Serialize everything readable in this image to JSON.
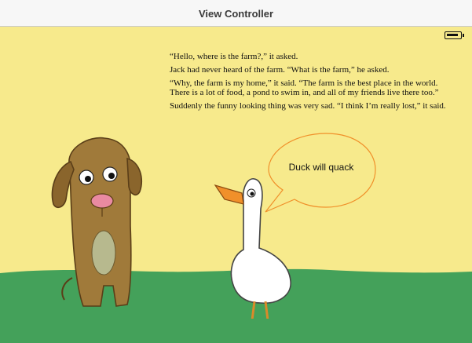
{
  "window": {
    "title": "View Controller"
  },
  "status_bar": {
    "battery_icon": "battery-icon"
  },
  "story": {
    "paragraphs": [
      "“Hello, where is the farm?,” it asked.",
      "Jack had never heard of the farm. “What is the farm,” he asked.",
      "“Why, the farm is my home,” it said. “The farm is the best place in the world. There is a lot of food, a pond to swim in, and all of my friends live there too.”",
      "Suddenly the funny looking thing was very sad. “I think I’m really lost,” it said."
    ]
  },
  "speech_bubble": {
    "text": "Duck will quack"
  },
  "colors": {
    "background": "#f7ea8c",
    "grass": "#44a15a",
    "bubble_border": "#f0902a",
    "dog": "#a07a3a",
    "duck": "#ffffff"
  }
}
